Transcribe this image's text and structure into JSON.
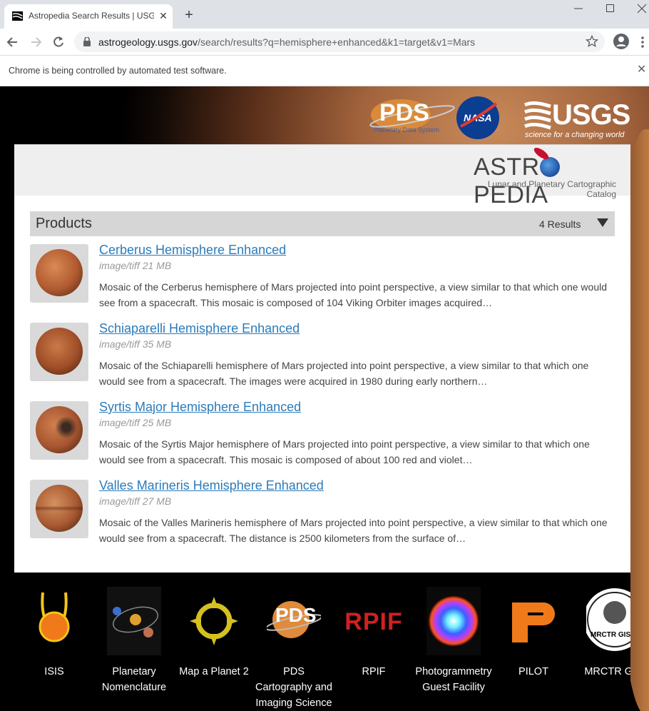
{
  "browser": {
    "tab_title": "Astropedia Search Results | USGS",
    "url_host": "astrogeology.usgs.gov",
    "url_path": "/search/results?q=hemisphere+enhanced&k1=target&v1=Mars",
    "infobar_text": "Chrome is being controlled by automated test software."
  },
  "header": {
    "usgs_word": "USGS",
    "usgs_tagline": "science for a changing world",
    "nasa_word": "NASA",
    "pds_word": "PDS",
    "pds_sub": "Planetary Data System",
    "astro_pre": "ASTR",
    "astro_post": "PEDIA",
    "astro_sub": "Lunar and Planetary Cartographic Catalog"
  },
  "products": {
    "title": "Products",
    "count": "4 Results"
  },
  "results": [
    {
      "title": "Cerberus Hemisphere Enhanced",
      "meta": "image/tiff 21 MB",
      "desc": "Mosaic of the Cerberus hemisphere of Mars projected into point perspective, a view similar to that which one would see from a spacecraft. This mosaic is composed of 104 Viking Orbiter images acquired…"
    },
    {
      "title": "Schiaparelli Hemisphere Enhanced",
      "meta": "image/tiff 35 MB",
      "desc": "Mosaic of the Schiaparelli hemisphere of Mars projected into point perspective, a view similar to that which one would see from a spacecraft. The images were acquired in 1980 during early northern…"
    },
    {
      "title": "Syrtis Major Hemisphere Enhanced",
      "meta": "image/tiff 25 MB",
      "desc": "Mosaic of the Syrtis Major hemisphere of Mars projected into point perspective, a view similar to that which one would see from a spacecraft. This mosaic is composed of about 100 red and violet…"
    },
    {
      "title": "Valles Marineris Hemisphere Enhanced",
      "meta": "image/tiff 27 MB",
      "desc": "Mosaic of the Valles Marineris hemisphere of Mars projected into point perspective, a view similar to that which one would see from a spacecraft. The distance is 2500 kilometers from the surface of…"
    }
  ],
  "footer": [
    {
      "label": "ISIS",
      "icon": "isis-icon"
    },
    {
      "label": "Planetary Nomenclature",
      "icon": "nomenclature-icon"
    },
    {
      "label": "Map a Planet 2",
      "icon": "map-a-planet-icon"
    },
    {
      "label": "PDS Cartography and Imaging Science",
      "icon": "pds-icon",
      "icon_text": "PDS"
    },
    {
      "label": "RPIF",
      "icon": "rpif-icon",
      "icon_text": "RPIF"
    },
    {
      "label": "Photogrammetry Guest Facility",
      "icon": "photogrammetry-icon"
    },
    {
      "label": "PILOT",
      "icon": "pilot-icon"
    },
    {
      "label": "MRCTR GIS",
      "icon": "mrctr-gis-icon",
      "icon_text": "MRCTR GIS"
    }
  ],
  "colors": {
    "link": "#2b7bba",
    "products_bar": "#d6d6d6",
    "panel_head": "#efefef"
  }
}
